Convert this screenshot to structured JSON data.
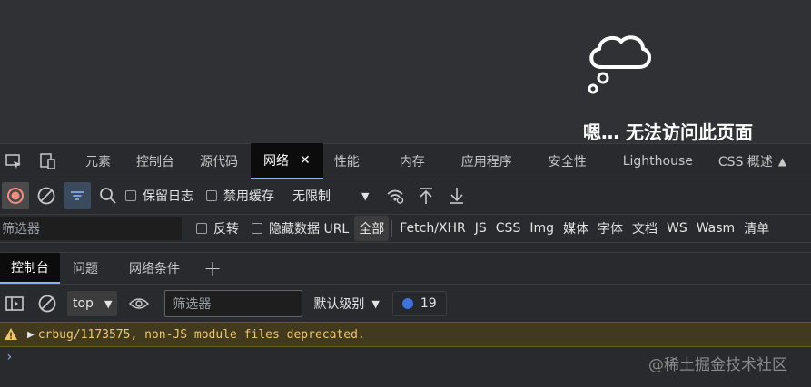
{
  "page": {
    "error_title": "嗯… 无法访问此页面"
  },
  "devtools_tabs": [
    {
      "label": "元素"
    },
    {
      "label": "控制台"
    },
    {
      "label": "源代码"
    },
    {
      "label": "网络",
      "active": true
    },
    {
      "label": "性能"
    },
    {
      "label": "内存"
    },
    {
      "label": "应用程序"
    },
    {
      "label": "安全性"
    },
    {
      "label": "Lighthouse"
    },
    {
      "label": "CSS 概述"
    }
  ],
  "network_toolbar": {
    "preserve_log": "保留日志",
    "disable_cache": "禁用缓存",
    "throttling": "无限制"
  },
  "filter_bar": {
    "placeholder": "筛选器",
    "invert": "反转",
    "hide_data_urls": "隐藏数据 URL",
    "types": [
      "全部",
      "Fetch/XHR",
      "JS",
      "CSS",
      "Img",
      "媒体",
      "字体",
      "文档",
      "WS",
      "Wasm",
      "清单"
    ]
  },
  "drawer_tabs": [
    "控制台",
    "问题",
    "网络条件"
  ],
  "console_toolbar": {
    "context": "top",
    "filter_placeholder": "筛选器",
    "level": "默认级别",
    "issues_count": "19"
  },
  "console": {
    "warning": "crbug/1173575, non-JS module files deprecated.",
    "prompt": "›"
  },
  "watermark": "@稀土掘金技术社区",
  "colors": {
    "accent": "#8ab4f8",
    "warning_text": "#f2c665",
    "warning_bg": "#413a1f",
    "issue_badge": "#3d73e0"
  }
}
